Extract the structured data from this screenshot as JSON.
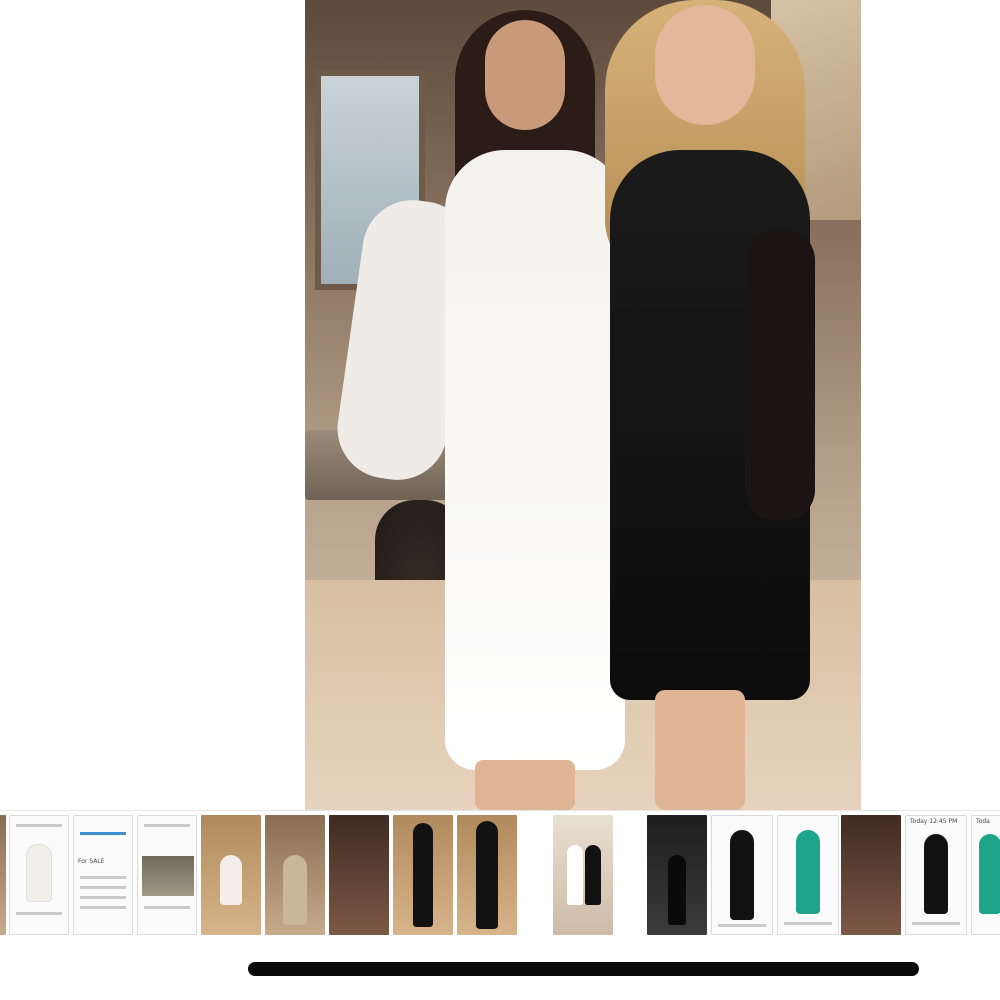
{
  "viewer": {
    "photo_alt": ""
  },
  "thumbnails": [
    {
      "kind": "edge-photo"
    },
    {
      "kind": "screenshot",
      "text": ""
    },
    {
      "kind": "screenshot",
      "text": "For SALE"
    },
    {
      "kind": "screenshot",
      "text": ""
    },
    {
      "kind": "photo-wood"
    },
    {
      "kind": "photo-warm"
    },
    {
      "kind": "photo-party"
    },
    {
      "kind": "photo-wood"
    },
    {
      "kind": "photo-wood"
    },
    {
      "kind": "selected"
    },
    {
      "kind": "photo-dark"
    },
    {
      "kind": "screenshot"
    },
    {
      "kind": "screenshot"
    },
    {
      "kind": "photo-party"
    },
    {
      "kind": "screenshot",
      "text": "Today 12:45 PM"
    },
    {
      "kind": "screenshot",
      "text": "Toda"
    }
  ],
  "colors": {
    "background": "#ffffff",
    "home_indicator": "#0a0a0a"
  }
}
